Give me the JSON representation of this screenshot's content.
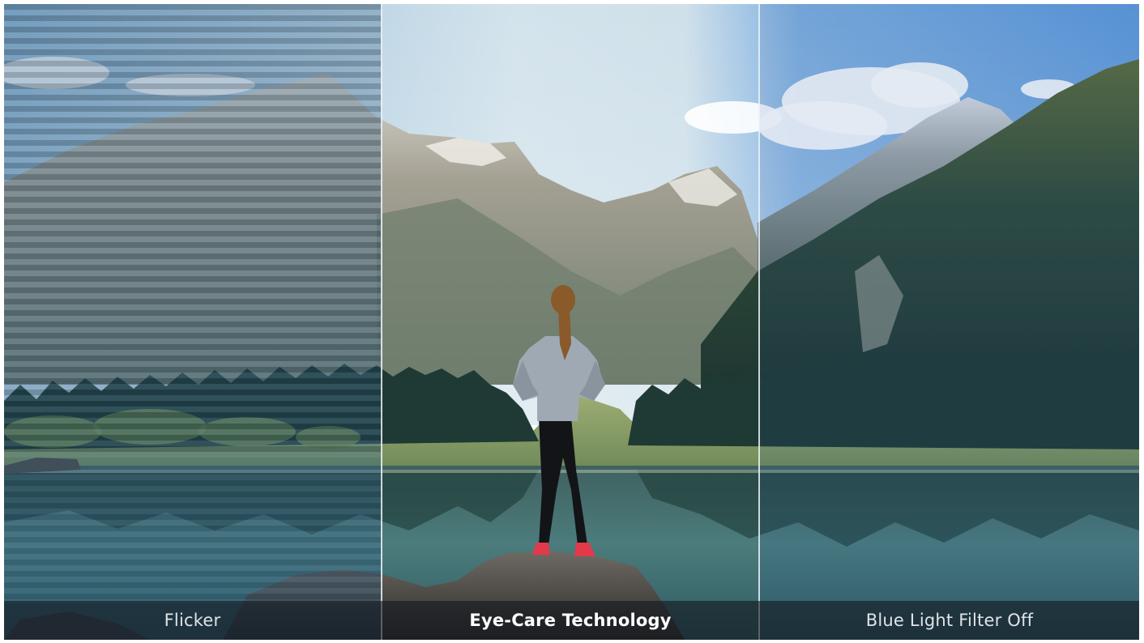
{
  "panels": [
    {
      "id": "flicker",
      "label": "Flicker"
    },
    {
      "id": "eye-care",
      "label": "Eye-Care Technology"
    },
    {
      "id": "blue-light-off",
      "label": "Blue Light Filter Off"
    }
  ],
  "colors": {
    "sky_center": "#cfe0ea",
    "sky_right": "#6fa6de",
    "mountain_rock": "#8d8f86",
    "forest_dark": "#1f3a34",
    "lake": "#3d6e73",
    "flicker_tint": "#2f5e86",
    "jacket": "#9fa9b4",
    "leggings": "#121418",
    "shoes": "#e23a4a",
    "hair": "#8a5a2b"
  },
  "icons": {
    "person": "hiker-standing-on-rock"
  }
}
